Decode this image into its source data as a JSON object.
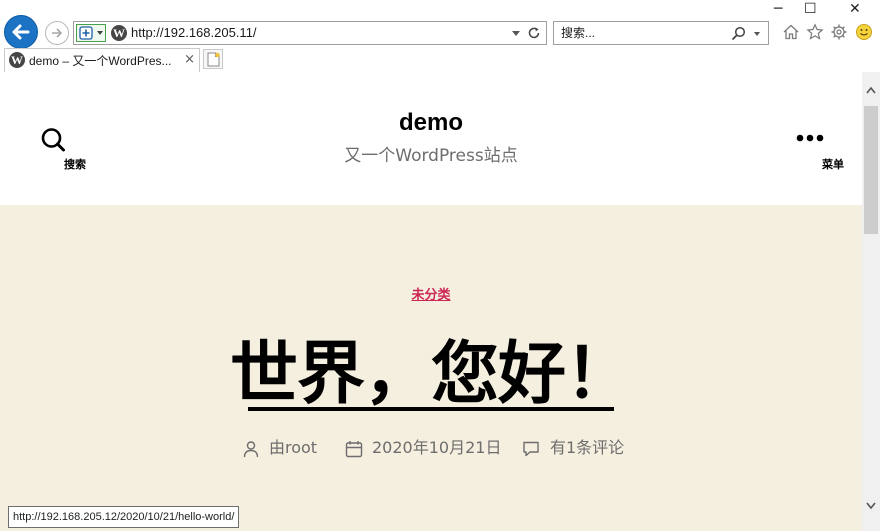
{
  "window": {
    "minimize_glyph": "─",
    "maximize_glyph": "☐",
    "close_glyph": "✕"
  },
  "toolbar": {
    "url": "http://192.168.205.11/",
    "search_placeholder": "搜索..."
  },
  "tabs": [
    {
      "title": "demo – 又一个WordPres...",
      "close_glyph": "×"
    }
  ],
  "site": {
    "title": "demo",
    "description": "又一个WordPress站点",
    "search_label": "搜索",
    "menu_label": "菜单"
  },
  "post": {
    "category": "未分类",
    "title": "世界，您好！",
    "author": "由root",
    "date": "2020年10月21日",
    "comments": "有1条评论"
  },
  "status_bar": {
    "hover_url": "http://192.168.205.12/2020/10/21/hello-world/"
  },
  "colors": {
    "accent": "#cd2653",
    "hero_bg": "#f5efe0",
    "back_button": "#1c73c3",
    "meta_text": "#6d6d6d"
  },
  "icons": [
    "back-arrow-icon",
    "forward-arrow-icon",
    "security-shield-icon",
    "wordpress-icon",
    "refresh-icon",
    "search-icon",
    "home-icon",
    "star-icon",
    "gear-icon",
    "smiley-icon",
    "new-tab-icon",
    "menu-dots-icon",
    "user-icon",
    "calendar-icon",
    "comment-icon",
    "scroll-up-arrow-icon",
    "scroll-down-arrow-icon"
  ]
}
